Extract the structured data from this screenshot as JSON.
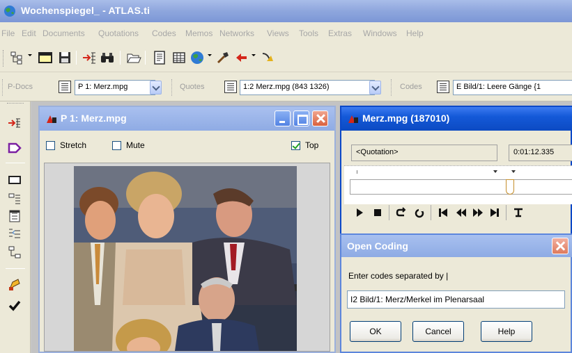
{
  "app": {
    "title": "Wochenspiegel_ - ATLAS.ti"
  },
  "menu": [
    "File",
    "Edit",
    "Documents",
    "Quotations",
    "Codes",
    "Memos",
    "Networks",
    "Views",
    "Tools",
    "Extras",
    "Windows",
    "Help"
  ],
  "selectors": {
    "pdocs_label": "P-Docs",
    "pdocs_value": "P 1: Merz.mpg",
    "quotes_label": "Quotes",
    "quotes_value": "1:2 Merz.mpg (843 1326)",
    "codes_label": "Codes",
    "codes_value": "E Bild/1: Leere Gänge {1"
  },
  "p1_window": {
    "title": "P 1: Merz.mpg",
    "stretch_label": "Stretch",
    "stretch_checked": false,
    "mute_label": "Mute",
    "mute_checked": false,
    "top_label": "Top",
    "top_checked": true
  },
  "merz_window": {
    "title": "Merz.mpg (187010)",
    "quotation_field": "<Quotation>",
    "time_field": "0:01:12.335",
    "playhead_fraction": 0.72
  },
  "open_coding": {
    "title": "Open Coding",
    "prompt": "Enter codes separated by |",
    "input_value": "I2 Bild/1: Merz/Merkel im Plenarsaal",
    "ok_label": "OK",
    "cancel_label": "Cancel",
    "help_label": "Help"
  },
  "colors": {
    "titlebar_active": "#0c4ac2",
    "titlebar_inactive": "#8fabe4",
    "face": "#ece9d8",
    "disabled_text": "#a7a7a7"
  }
}
